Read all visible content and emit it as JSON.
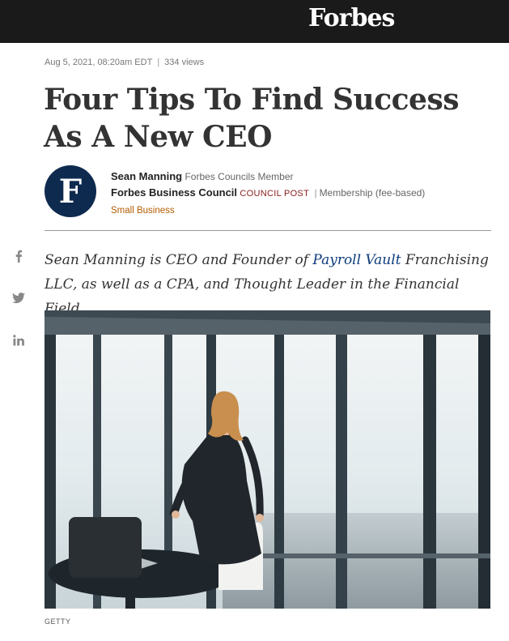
{
  "header": {
    "logo": "Forbes"
  },
  "article": {
    "date": "Aug 5, 2021, 08:20am EDT",
    "separator": "|",
    "views": "334 views",
    "title": "Four Tips To Find Success As A New CEO",
    "author": {
      "avatar_letter": "F",
      "name": "Sean Manning",
      "role": "Forbes Councils Member",
      "council": "Forbes Business Council",
      "post_type": "COUNCIL POST",
      "pipe": "|",
      "membership": "Membership (fee-based)",
      "topic": "Small Business"
    },
    "lede": {
      "part1": "Sean Manning is CEO and Founder of ",
      "link": "Payroll Vault",
      "part2": " Franchising LLC, as well as a CPA, and Thought Leader in the Financial Field."
    },
    "image_credit": "GETTY"
  },
  "social": {
    "icons": [
      "facebook-icon",
      "twitter-icon",
      "linkedin-icon"
    ],
    "color": "#888888"
  },
  "colors": {
    "topbar": "#1a1a1a",
    "avatar": "#0e2a4f",
    "council_post": "#8a1c1c",
    "topic": "#b35c00",
    "link": "#0b3a7a"
  }
}
